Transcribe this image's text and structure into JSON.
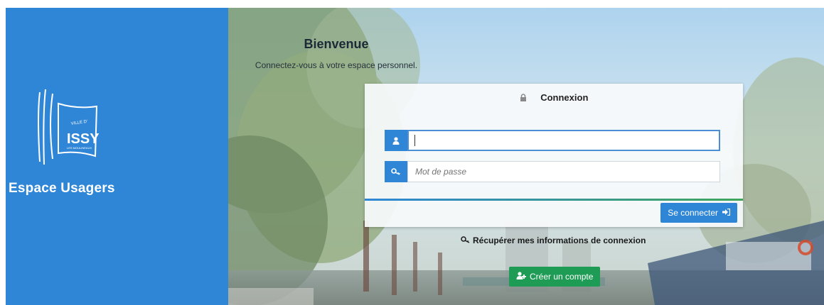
{
  "sidebar": {
    "brand_text": "Espace Usagers",
    "logo_text": "ISSY",
    "logo_small_top": "VILLE D'",
    "logo_small_bottom": "LES MOULINEAUX"
  },
  "header": {
    "title": "Bienvenue",
    "subtitle": "Connectez-vous à votre espace personnel."
  },
  "login_card": {
    "title": "Connexion",
    "username": {
      "value": "",
      "placeholder": ""
    },
    "password": {
      "value": "",
      "placeholder": "Mot de passe"
    },
    "submit_label": "Se connecter"
  },
  "links": {
    "recover_label": "Récupérer mes informations de connexion",
    "create_account_label": "Créer un compte"
  },
  "colors": {
    "primary": "#2f86d6",
    "success": "#1e9b54"
  },
  "icons": [
    "lock-icon",
    "user-icon",
    "key-icon",
    "sign-in-icon",
    "add-user-icon"
  ]
}
